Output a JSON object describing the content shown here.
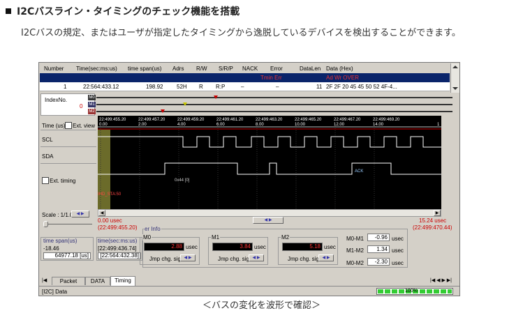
{
  "heading": "I2Cバスライン・タイミングのチェック機能を搭載",
  "description": "I2Cバスの規定、またはユーザが指定したタイミングから逸脱しているデバイスを検出することができます。",
  "caption": "＜バスの変化を波形で確認＞",
  "table": {
    "columns": [
      "Number",
      "Time(sec:ms:us)",
      "time span(us)",
      "Adrs",
      "R/W",
      "S/R/P",
      "NACK",
      "Error",
      "DataLen",
      "Data (Hex)"
    ],
    "selected_row": {
      "error": "Tmin Err",
      "data": "Ad  Wr  OVER"
    },
    "row": {
      "number": "1",
      "time": "22:564:433.12",
      "span": "198.92",
      "adrs": "52H",
      "rw": "R",
      "srp": "R:P",
      "nack": "–",
      "error": "–",
      "datalen": "11",
      "data": "2F 2F 20 45 45 50 52 4F-4..."
    }
  },
  "index_panel": {
    "label": "IndexNo.",
    "value": "0",
    "markers": [
      "M0",
      "M1",
      "M2"
    ]
  },
  "time_labels": [
    {
      "t": "22:499:455.20",
      "u": "0.00"
    },
    {
      "t": "22:499:457.20",
      "u": "2.00"
    },
    {
      "t": "22:499:459.20",
      "u": "4.00"
    },
    {
      "t": "22:499:461.20",
      "u": "6.00"
    },
    {
      "t": "22:499:463.20",
      "u": "8.00"
    },
    {
      "t": "22:499:465.20",
      "u": "10.00"
    },
    {
      "t": "22:499:467.20",
      "u": "12.00"
    },
    {
      "t": "22:499:469.20",
      "u": "14.00"
    }
  ],
  "timescale_last": "1",
  "left": {
    "time_us": "Time (us)",
    "ext_view": "Ext. view",
    "scl": "SCL",
    "sda": "SDA",
    "ext_timing": "Ext. timing",
    "scale": "Scale : 1/1.0"
  },
  "wave_labels": {
    "addr": "0x44 [0]",
    "ack": "ACK",
    "start": "IHD_STA:50"
  },
  "range": {
    "left_usec": "0.00 usec",
    "left_abs": "(22:499:455.20)",
    "right_usec": "15.24 usec",
    "right_abs": "(22:499:470.44)"
  },
  "time_span": {
    "label": "time span(us)",
    "v1": "-18.46 ",
    "v2": "64977.18 [us]"
  },
  "time_abs": {
    "label": "time(sec:ms:us)",
    "v1": "[22:499:436.74]",
    "v2": "[22:564:432.38]"
  },
  "cursor": {
    "title": "er Info",
    "m0": {
      "label": "M0",
      "value": "2.88",
      "unit": "usec",
      "jmp": "Jmp chg. signal"
    },
    "m1": {
      "label": "M1",
      "value": "3.84",
      "unit": "usec",
      "jmp": "Jmp chg. signal"
    },
    "m2": {
      "label": "M2",
      "value": "5.18",
      "unit": "usec",
      "jmp": "Jmp chg. signal"
    },
    "diffs": [
      {
        "label": "M0-M1",
        "value": "-0.96",
        "unit": "usec"
      },
      {
        "label": "M1-M2",
        "value": "1.34",
        "unit": "usec"
      },
      {
        "label": "M0-M2",
        "value": "-2.30",
        "unit": "usec"
      }
    ]
  },
  "tabs": [
    "Packet",
    "DATA",
    "Timing"
  ],
  "status": {
    "left": "[I2C] Data",
    "progress": "100%",
    "progress_fraction": 1.0
  },
  "colors": {
    "wave_bg": "#000000",
    "scl": "#ffffff",
    "sda": "#ffffff",
    "start_region": "#6b6b2a",
    "marker_red": "#cc0000",
    "selected_row": "#0a246a"
  }
}
